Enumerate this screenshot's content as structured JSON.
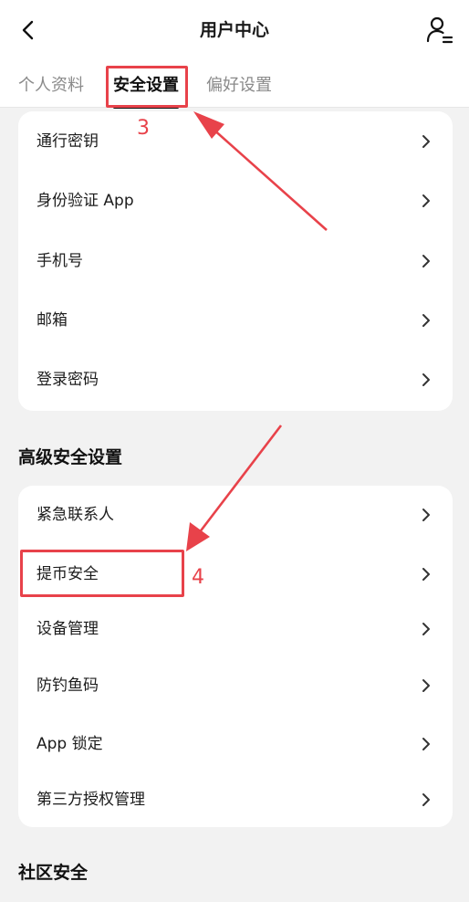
{
  "header": {
    "title": "用户中心",
    "back_icon": "chevron-left-icon",
    "user_icon": "user-settings-icon"
  },
  "tabs": [
    {
      "label": "个人资料",
      "active": false
    },
    {
      "label": "安全设置",
      "active": true
    },
    {
      "label": "偏好设置",
      "active": false
    }
  ],
  "security_items": [
    {
      "label": "通行密钥"
    },
    {
      "label": "身份验证 App"
    },
    {
      "label": "手机号"
    },
    {
      "label": "邮箱"
    },
    {
      "label": "登录密码"
    }
  ],
  "advanced_section": {
    "title": "高级安全设置",
    "items": [
      {
        "label": "紧急联系人"
      },
      {
        "label": "提币安全"
      },
      {
        "label": "设备管理"
      },
      {
        "label": "防钓鱼码"
      },
      {
        "label": "App 锁定"
      },
      {
        "label": "第三方授权管理"
      }
    ]
  },
  "community_section": {
    "title": "社区安全"
  },
  "annotations": [
    {
      "number": "3",
      "color": "#e8424a"
    },
    {
      "number": "4",
      "color": "#e8424a"
    }
  ]
}
